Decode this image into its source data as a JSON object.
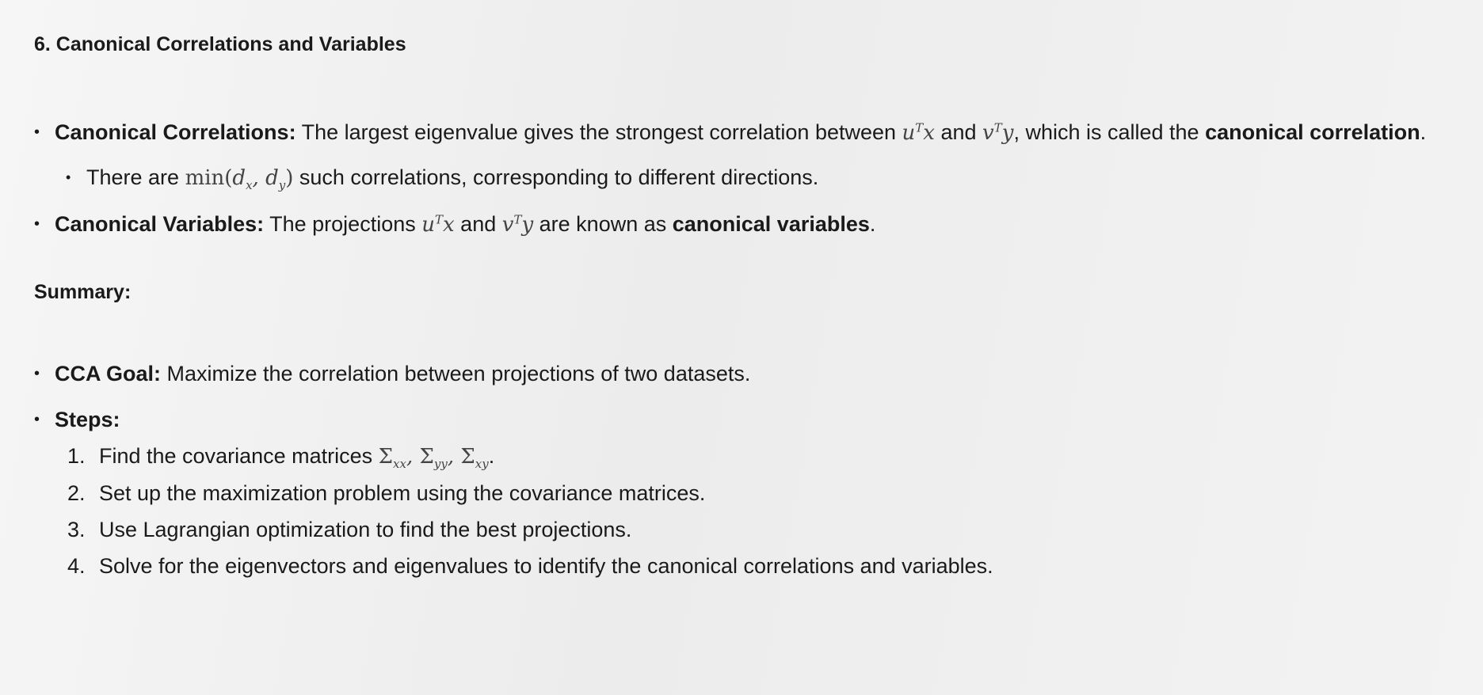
{
  "section6": {
    "heading": "6. Canonical Correlations and Variables",
    "canonical_correlations": {
      "label": "Canonical Correlations:",
      "text1": " The largest eigenvalue gives the strongest correlation between ",
      "and": " and ",
      "text2": ", which is called the ",
      "bold_term": "canonical correlation",
      "end": "."
    },
    "sub_point": {
      "text1": "There are ",
      "text2": " such correlations, corresponding to different directions."
    },
    "canonical_variables": {
      "label": "Canonical Variables:",
      "text1": " The projections ",
      "and": " and ",
      "text2": " are known as ",
      "bold_term": "canonical variables",
      "end": "."
    }
  },
  "summary": {
    "heading": "Summary:",
    "goal_label": "CCA Goal:",
    "goal_text": " Maximize the correlation between projections of two datasets.",
    "steps_label": "Steps:",
    "steps": [
      {
        "num": "1.",
        "text": "Find the covariance matrices "
      },
      {
        "num": "2.",
        "text": "Set up the maximization problem using the covariance matrices."
      },
      {
        "num": "3.",
        "text": "Use Lagrangian optimization to find the best projections."
      },
      {
        "num": "4.",
        "text": "Solve for the eigenvectors and eigenvalues to identify the canonical correlations and variables."
      }
    ]
  }
}
